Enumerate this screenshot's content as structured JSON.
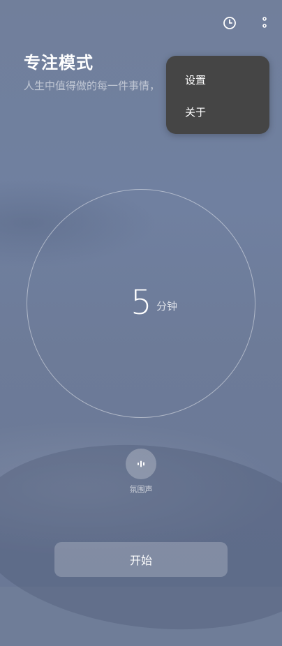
{
  "header": {
    "title": "专注模式",
    "subtitle": "人生中值得做的每一件事情，"
  },
  "topbar": {
    "history_icon": "clock-icon",
    "more_icon": "more-vertical-icon"
  },
  "menu": {
    "items": [
      {
        "label": "设置"
      },
      {
        "label": "关于"
      }
    ]
  },
  "timer": {
    "value": "5",
    "unit": "分钟"
  },
  "ambient": {
    "icon": "sound-wave-icon",
    "label": "氛围声"
  },
  "actions": {
    "start_label": "开始"
  },
  "colors": {
    "background": "#6f7d98",
    "menu_bg": "#454545",
    "text": "#ffffff"
  }
}
